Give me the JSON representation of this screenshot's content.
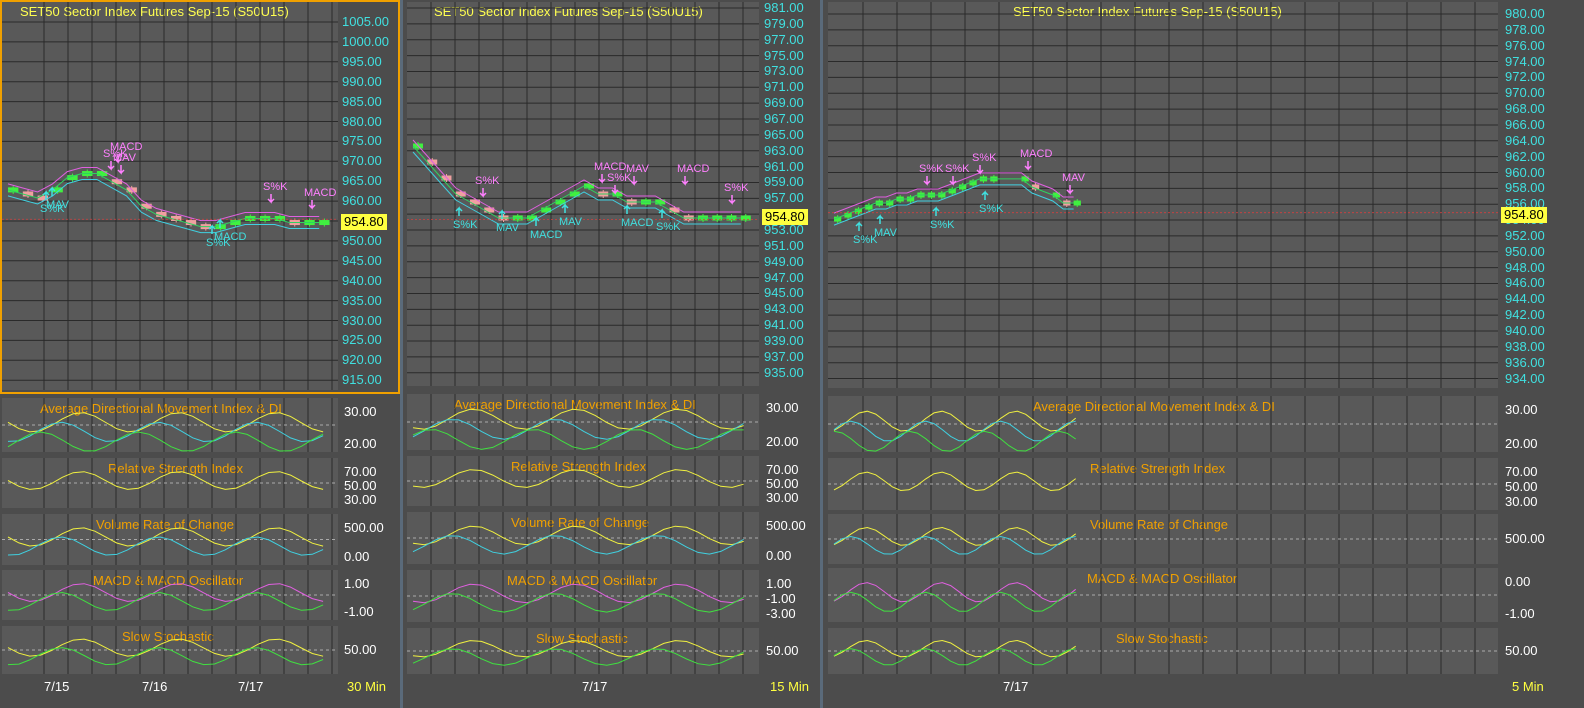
{
  "colors": {
    "title": "#ffff50",
    "indicator_title": "#f0a000",
    "axis_label": "#40e0e0",
    "price_tag_bg": "#ffff40",
    "candle_up": "#40f040",
    "candle_down": "#f0a0a0",
    "signal_sell": "#ff80ff",
    "signal_buy": "#40e0e0"
  },
  "panels": [
    {
      "id": "30min",
      "title": "SET50 Sector Index Futures Sep-15 (S50U15)",
      "timeframe": "30 Min",
      "last_price": "954.80",
      "price_axis": [
        "1005.00",
        "1000.00",
        "995.00",
        "990.00",
        "985.00",
        "980.00",
        "975.00",
        "970.00",
        "965.00",
        "960.00",
        "955.00",
        "950.00",
        "945.00",
        "940.00",
        "935.00",
        "930.00",
        "925.00",
        "920.00",
        "915.00"
      ],
      "date_labels": [
        "7/15",
        "7/16",
        "7/17"
      ],
      "signals": {
        "sell": [
          "MACD",
          "S%K",
          "MAV",
          "S%K",
          "MACD"
        ],
        "buy": [
          "S%K",
          "MAV",
          "MACD",
          "S%K"
        ]
      },
      "indicators": [
        {
          "title": "Average Directional Movement Index & DI",
          "axis": [
            "30.00",
            "20.00"
          ]
        },
        {
          "title": "Relative Strength Index",
          "axis": [
            "70.00",
            "50.00",
            "30.00"
          ]
        },
        {
          "title": "Volume Rate of Change",
          "axis": [
            "500.00",
            "0.00"
          ]
        },
        {
          "title": "MACD & MACD Oscillator",
          "axis": [
            "1.00",
            "-1.00"
          ]
        },
        {
          "title": "Slow Stochastic",
          "axis": [
            "50.00"
          ]
        }
      ]
    },
    {
      "id": "15min",
      "title": "SET50 Sector Index Futures Sep-15 (S50U15)",
      "timeframe": "15 Min",
      "last_price": "954.80",
      "price_axis": [
        "981.00",
        "979.00",
        "977.00",
        "975.00",
        "973.00",
        "971.00",
        "969.00",
        "967.00",
        "965.00",
        "963.00",
        "961.00",
        "959.00",
        "957.00",
        "955.00",
        "953.00",
        "951.00",
        "949.00",
        "947.00",
        "945.00",
        "943.00",
        "941.00",
        "939.00",
        "937.00",
        "935.00"
      ],
      "date_labels": [
        "7/17"
      ],
      "signals": {
        "sell": [
          "S%K",
          "MACD",
          "S%K",
          "MAV",
          "MACD",
          "S%K",
          "MACD",
          "S%K"
        ],
        "buy": [
          "S%K",
          "MAV",
          "MACD",
          "MAV",
          "MACD",
          "S%K"
        ]
      },
      "indicators": [
        {
          "title": "Average Directional Movement Index & DI",
          "axis": [
            "30.00",
            "20.00"
          ]
        },
        {
          "title": "Relative Strength Index",
          "axis": [
            "70.00",
            "50.00",
            "30.00"
          ]
        },
        {
          "title": "Volume Rate of Change",
          "axis": [
            "500.00",
            "0.00"
          ]
        },
        {
          "title": "MACD & MACD Oscillator",
          "axis": [
            "1.00",
            "-1.00",
            "-3.00"
          ]
        },
        {
          "title": "Slow Stochastic",
          "axis": [
            "50.00"
          ]
        }
      ]
    },
    {
      "id": "5min",
      "title": "SET50 Sector Index Futures Sep-15 (S50U15)",
      "timeframe": "5 Min",
      "last_price": "954.80",
      "price_axis": [
        "980.00",
        "978.00",
        "976.00",
        "974.00",
        "972.00",
        "970.00",
        "968.00",
        "966.00",
        "964.00",
        "962.00",
        "960.00",
        "958.00",
        "956.00",
        "954.00",
        "952.00",
        "950.00",
        "948.00",
        "946.00",
        "944.00",
        "942.00",
        "940.00",
        "938.00",
        "936.00",
        "934.00"
      ],
      "date_labels": [
        "7/17"
      ],
      "signals": {
        "sell": [
          "S%K",
          "S%K",
          "S%K",
          "MACD",
          "MAV"
        ],
        "buy": [
          "S%K",
          "MAV",
          "S%K",
          "S%K"
        ]
      },
      "indicators": [
        {
          "title": "Average Directional Movement Index & DI",
          "axis": [
            "30.00",
            "20.00"
          ]
        },
        {
          "title": "Relative Strength Index",
          "axis": [
            "70.00",
            "50.00",
            "30.00"
          ]
        },
        {
          "title": "Volume Rate of Change",
          "axis": [
            "500.00"
          ]
        },
        {
          "title": "MACD & MACD Oscillator",
          "axis": [
            "0.00",
            "-1.00"
          ]
        },
        {
          "title": "Slow Stochastic",
          "axis": [
            "50.00"
          ]
        }
      ]
    }
  ],
  "chart_data": [
    {
      "type": "line",
      "title": "SET50 Sector Index Futures Sep-15 (S50U15)",
      "timeframe": "30 Min",
      "ylim": [
        913,
        1008
      ],
      "last": 954.8,
      "x": [
        "7/15",
        "7/16",
        "7/17"
      ],
      "series": [
        {
          "values": [
            962,
            961,
            960,
            962,
            965,
            966,
            966,
            964,
            962,
            958,
            956,
            955,
            954,
            953,
            953,
            954,
            955,
            955,
            955,
            954,
            954,
            954
          ]
        }
      ]
    },
    {
      "type": "line",
      "title": "SET50 Sector Index Futures Sep-15 (S50U15)",
      "timeframe": "15 Min",
      "ylim": [
        934,
        982
      ],
      "last": 954.8,
      "x": [
        "7/17"
      ],
      "series": [
        {
          "values": [
            964,
            962,
            960,
            958,
            957,
            956,
            955,
            955,
            955,
            956,
            957,
            958,
            959,
            958,
            958,
            957,
            957,
            957,
            956,
            955,
            955,
            955,
            955,
            955
          ]
        }
      ]
    },
    {
      "type": "line",
      "title": "SET50 Sector Index Futures Sep-15 (S50U15)",
      "timeframe": "5 Min",
      "ylim": [
        933,
        981
      ],
      "last": 954.8,
      "x": [
        "7/17"
      ],
      "series": [
        {
          "values": [
            954,
            954.5,
            955,
            955.5,
            956,
            956,
            956.5,
            956.5,
            957,
            957,
            957,
            957.5,
            958,
            958.5,
            959,
            959,
            null,
            null,
            959,
            958,
            null,
            957,
            956,
            956
          ]
        }
      ]
    }
  ]
}
